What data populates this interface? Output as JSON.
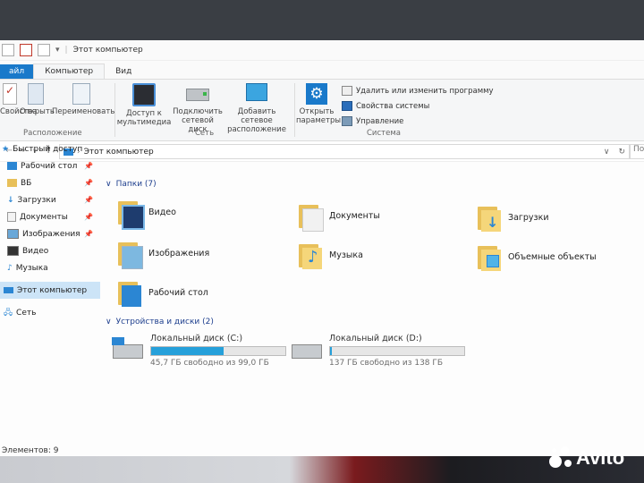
{
  "window": {
    "title": "Этот компьютер"
  },
  "tabs": [
    "айл",
    "Компьютер",
    "Вид"
  ],
  "ribbon": {
    "location_buttons": [
      "Свойства",
      "Открыть",
      "Переименовать"
    ],
    "location_group": "Расположение",
    "network_buttons": [
      {
        "line1": "Доступ к",
        "line2": "мультимедиа"
      },
      {
        "line1": "Подключить",
        "line2": "сетевой диск"
      },
      {
        "line1": "Добавить сетевое",
        "line2": "расположение"
      }
    ],
    "network_group": "Сеть",
    "open_params": {
      "line1": "Открыть",
      "line2": "параметры"
    },
    "system_small": [
      "Удалить или изменить программу",
      "Свойства системы",
      "Управление"
    ],
    "system_group": "Система"
  },
  "address": {
    "path": "Этот компьютер",
    "search_placeholder": "По"
  },
  "nav_pane": {
    "quick_access": "Быстрый доступ",
    "items": [
      "Рабочий стол",
      "ВБ",
      "Загрузки",
      "Документы",
      "Изображения",
      "Видео",
      "Музыка"
    ],
    "this_pc": "Этот компьютер",
    "network": "Сеть"
  },
  "folders": {
    "header": "Папки (7)",
    "items": [
      "Видео",
      "Документы",
      "Загрузки",
      "Изображения",
      "Музыка",
      "Объемные объекты",
      "Рабочий стол"
    ]
  },
  "devices": {
    "header": "Устройства и диски (2)",
    "drives": [
      {
        "name": "Локальный диск (C:)",
        "free_text": "45,7 ГБ свободно из 99,0 ГБ",
        "used_fraction": 0.54
      },
      {
        "name": "Локальный диск (D:)",
        "free_text": "137 ГБ свободно из 138 ГБ",
        "used_fraction": 0.01
      }
    ]
  },
  "status": {
    "items": "Элементов: 9"
  },
  "watermark": "Avito"
}
